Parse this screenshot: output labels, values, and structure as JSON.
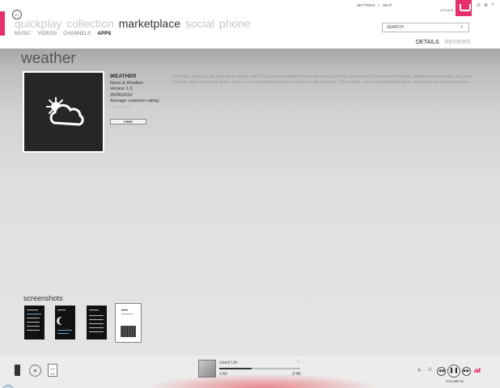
{
  "colors": {
    "accent": "#e6306b",
    "background": "#ececec"
  },
  "header": {
    "back_icon": "back-arrow-icon",
    "pivots": [
      {
        "label": "quickplay",
        "active": false
      },
      {
        "label": "collection",
        "active": false
      },
      {
        "label": "marketplace",
        "active": true
      },
      {
        "label": "social",
        "active": false
      },
      {
        "label": "phone",
        "active": false
      }
    ],
    "subnav": [
      {
        "label": "MUSIC",
        "active": false
      },
      {
        "label": "VIDEOS",
        "active": false
      },
      {
        "label": "CHANNELS",
        "active": false
      },
      {
        "label": "APPS",
        "active": true
      }
    ],
    "settings_label": "SETTINGS",
    "separator": "|",
    "help_label": "HELP",
    "player_name": "X PLAYS",
    "window_controls": [
      "⊖",
      "⊕",
      "×"
    ],
    "search": {
      "placeholder": "SEARCH"
    },
    "tabs": [
      {
        "label": "DETAILS",
        "active": true
      },
      {
        "label": "REVIEWS",
        "active": false
      }
    ]
  },
  "app": {
    "page_title": "weather",
    "name": "WEATHER",
    "category": "News & Weather",
    "version": "Version 1.0",
    "date": "26/06/2010",
    "rating_label": "Average customer rating:",
    "rating_stars": "☆☆☆☆☆",
    "price_label": "FREE",
    "icon": "weather-sun-cloud-icon",
    "description": "Is the day calling for an umbrella or suntan lotion? Get pin-point weather forecasts and you'll know. Keep track of your current location, updated automatically, plus your favourite cities around the globe. View current conditions and check out the 10-day forecast. The weather, and its unpredictable quirks, tracked in one convenient spot."
  },
  "screenshots": {
    "title": "screenshots",
    "items": [
      {
        "name": "screenshot-locations"
      },
      {
        "name": "screenshot-today"
      },
      {
        "name": "screenshot-forecast"
      },
      {
        "name": "screenshot-keyboard"
      }
    ]
  },
  "now_playing": {
    "title": "Island Life",
    "elapsed": "1:50",
    "remaining": "-2:48",
    "progress": 0.4
  },
  "controls": {
    "repeat_icon": "repeat-icon",
    "shuffle_icon": "shuffle-icon",
    "prev_icon": "previous-icon",
    "pause_icon": "pause-icon",
    "next_icon": "next-icon",
    "volume_label": "VOLUME 50"
  }
}
